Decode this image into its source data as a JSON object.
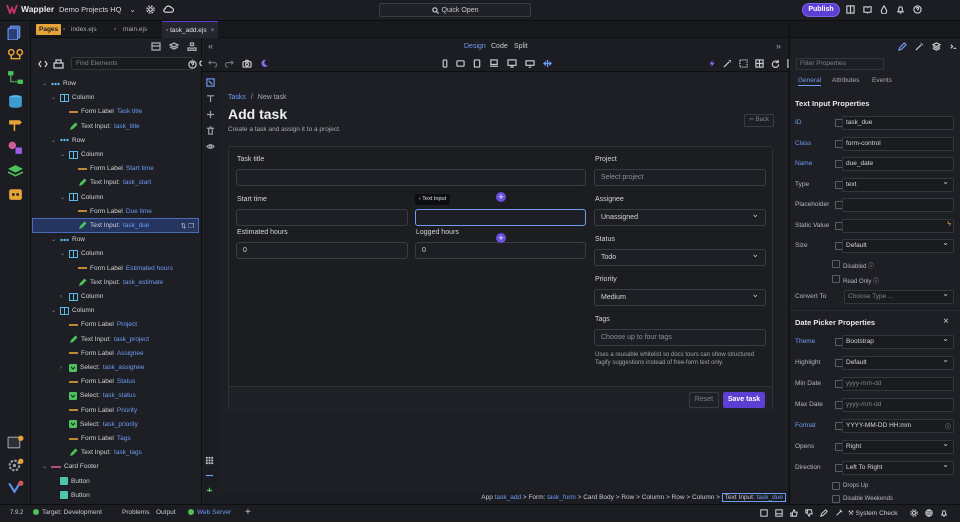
{
  "topbar": {
    "app_name": "Wappler",
    "project": "Demo Projects HQ",
    "quick_open": "Quick Open",
    "publish": "Publish"
  },
  "panel": {
    "pages_badge": "Pages",
    "tabs": [
      "index.ejs",
      "main.ejs",
      "task_add.ejs"
    ],
    "find_placeholder": "Find Elements",
    "tree": [
      {
        "label": "Row",
        "value": ""
      },
      {
        "label": "Column",
        "value": ""
      },
      {
        "label": "Form Label",
        "value": "Task title"
      },
      {
        "label": "Text Input:",
        "value": "task_title"
      },
      {
        "label": "Row",
        "value": ""
      },
      {
        "label": "Column",
        "value": ""
      },
      {
        "label": "Form Label",
        "value": "Start time"
      },
      {
        "label": "Text Input:",
        "value": "task_start"
      },
      {
        "label": "Column",
        "value": ""
      },
      {
        "label": "Form Label",
        "value": "Due time"
      },
      {
        "label": "Text Input:",
        "value": "task_due"
      },
      {
        "label": "Row",
        "value": ""
      },
      {
        "label": "Column",
        "value": ""
      },
      {
        "label": "Form Label",
        "value": "Estimated hours"
      },
      {
        "label": "Text Input:",
        "value": "task_estimate"
      },
      {
        "label": "Column",
        "value": ""
      },
      {
        "label": "Column",
        "value": ""
      },
      {
        "label": "Form Label",
        "value": "Project"
      },
      {
        "label": "Text Input:",
        "value": "task_project"
      },
      {
        "label": "Form Label",
        "value": "Assignee"
      },
      {
        "label": "Select:",
        "value": "task_assignee"
      },
      {
        "label": "Form Label",
        "value": "Status"
      },
      {
        "label": "Select:",
        "value": "task_status"
      },
      {
        "label": "Form Label",
        "value": "Priority"
      },
      {
        "label": "Select:",
        "value": "task_priority"
      },
      {
        "label": "Form Label",
        "value": "Tags"
      },
      {
        "label": "Text Input:",
        "value": "task_tags"
      },
      {
        "label": "Card Footer",
        "value": ""
      },
      {
        "label": "Button",
        "value": ""
      },
      {
        "label": "Button",
        "value": ""
      }
    ]
  },
  "editor": {
    "modes": [
      "Design",
      "Code",
      "Split"
    ]
  },
  "page": {
    "breadcrumb_link": "Tasks",
    "breadcrumb_sep": "/",
    "breadcrumb_current": "New task",
    "title": "Add task",
    "subtitle": "Create a task and assign it to a project.",
    "back": "Back",
    "fields": {
      "task_title": "Task title",
      "start_time": "Start time",
      "estimated_hours": "Estimated hours",
      "estimated_value": "0",
      "logged_hours": "Logged hours",
      "logged_value": "0",
      "project": "Project",
      "project_placeholder": "Select project",
      "assignee": "Assignee",
      "assignee_value": "Unassigned",
      "status": "Status",
      "status_value": "Todo",
      "priority": "Priority",
      "priority_value": "Medium",
      "tags": "Tags",
      "tags_placeholder": "Choose up to four tags",
      "tags_hint": "Uses a reusable whitelist so docs tours can show structured Tagify suggestions instead of free-form text only."
    },
    "tooltip": "Text Input",
    "reset": "Reset",
    "save": "Save task"
  },
  "path": {
    "items": [
      {
        "t": "App",
        "v": "task_add"
      },
      {
        "t": "> Form:",
        "v": "task_form"
      },
      {
        "t": "> Card Body",
        "v": ""
      },
      {
        "t": "> Row",
        "v": ""
      },
      {
        "t": "> Column",
        "v": ""
      },
      {
        "t": "> Row",
        "v": ""
      },
      {
        "t": "> Column >",
        "v": ""
      }
    ],
    "current_label": "Text Input:",
    "current_value": "task_due"
  },
  "props": {
    "filter_placeholder": "Filter Properties",
    "tabs": [
      "General",
      "Attributes",
      "Events"
    ],
    "section1": "Text Input Properties",
    "rows1": [
      {
        "label": "ID",
        "value": "task_due",
        "ph": false,
        "dd": false,
        "link": true
      },
      {
        "label": "Class",
        "value": "form-control",
        "ph": false,
        "dd": false,
        "link": true
      },
      {
        "label": "Name",
        "value": "due_date",
        "ph": false,
        "dd": false,
        "link": true
      },
      {
        "label": "Type",
        "value": "text",
        "ph": false,
        "dd": true,
        "link": false
      },
      {
        "label": "Placeholder",
        "value": "",
        "ph": false,
        "dd": false,
        "link": false
      },
      {
        "label": "Static Value",
        "value": "",
        "ph": false,
        "dd": false,
        "link": false
      },
      {
        "label": "Size",
        "value": "Default",
        "ph": false,
        "dd": true,
        "link": false
      }
    ],
    "disabled": "Disabled",
    "read_only": "Read Only",
    "convert_to": "Convert To",
    "convert_placeholder": "Choose Type ...",
    "section2": "Date Picker Properties",
    "rows2": [
      {
        "label": "Theme",
        "value": "Bootstrap",
        "ph": false,
        "dd": true,
        "link": true
      },
      {
        "label": "Highlight",
        "value": "Default",
        "ph": false,
        "dd": true,
        "link": false
      },
      {
        "label": "Min Date",
        "value": "yyyy-mm-dd",
        "ph": true,
        "dd": false,
        "link": false
      },
      {
        "label": "Max Date",
        "value": "yyyy-mm-dd",
        "ph": true,
        "dd": false,
        "link": false
      },
      {
        "label": "Format",
        "value": "YYYY-MM-DD HH:mm",
        "ph": false,
        "dd": false,
        "link": true
      },
      {
        "label": "Opens",
        "value": "Right",
        "ph": false,
        "dd": true,
        "link": false
      },
      {
        "label": "Direction",
        "value": "Left To Right",
        "ph": false,
        "dd": true,
        "link": false
      }
    ],
    "drops_up": "Drops Up",
    "disable_weekends": "Disable Weekends"
  },
  "status": {
    "version": "7.9.2",
    "target": "Target: Development",
    "problems": "Problems",
    "output": "Output",
    "web_server": "Web Server",
    "system_check": "System Check"
  },
  "colors": {
    "accent": "#5d3fd3",
    "link": "#6d9cf5",
    "ok": "#4cc35a"
  }
}
